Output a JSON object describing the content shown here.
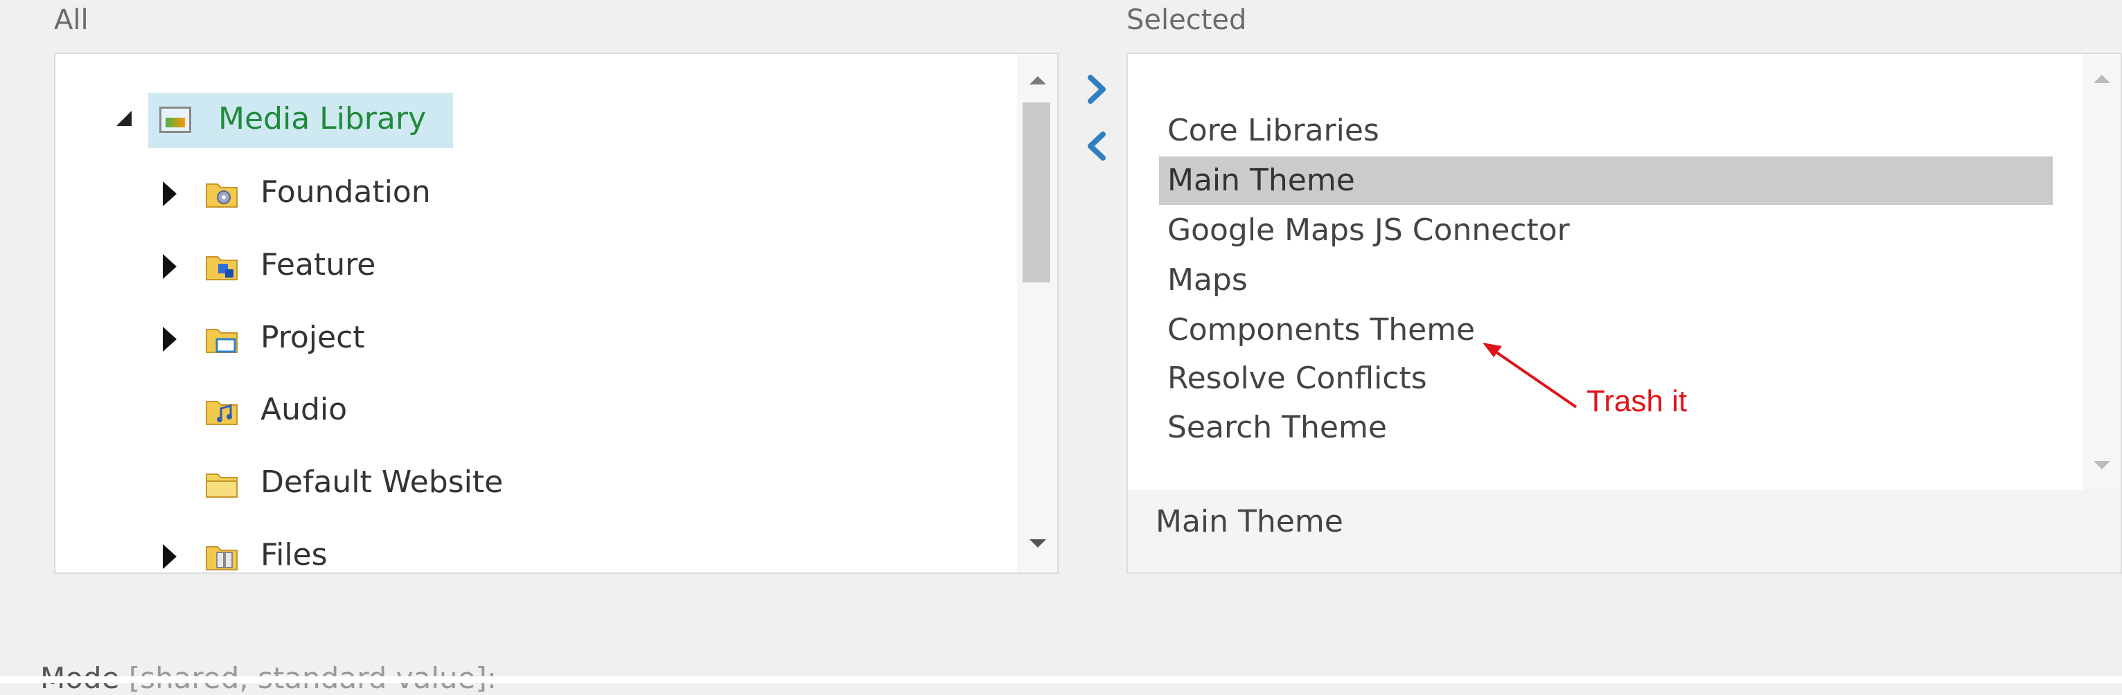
{
  "all_label": "All",
  "selected_label": "Selected",
  "tree": {
    "root": {
      "label": "Media Library",
      "icon": "media-library-icon",
      "expanded": true
    },
    "children": [
      {
        "label": "Foundation",
        "icon": "folder-gear-icon",
        "has_children": true
      },
      {
        "label": "Feature",
        "icon": "folder-blue-icon",
        "has_children": true
      },
      {
        "label": "Project",
        "icon": "folder-window-icon",
        "has_children": true
      },
      {
        "label": "Audio",
        "icon": "folder-audio-icon",
        "has_children": false
      },
      {
        "label": "Default Website",
        "icon": "folder-icon",
        "has_children": false
      },
      {
        "label": "Files",
        "icon": "folder-files-icon",
        "has_children": true
      }
    ]
  },
  "selected": {
    "items": [
      "Core Libraries",
      "Main Theme",
      "Google Maps JS Connector",
      "Maps",
      "Components Theme",
      "Resolve Conflicts",
      "Search Theme"
    ],
    "active_index": 1,
    "footer": "Main Theme"
  },
  "annotation": {
    "text": "Trash it",
    "color": "#e0131a"
  },
  "mode": {
    "label": "Mode",
    "hint": "[shared, standard value]:"
  },
  "colors": {
    "accent_blue": "#2f7fc1",
    "highlight": "#cfe9f2",
    "active_row": "#cbcbcb"
  }
}
